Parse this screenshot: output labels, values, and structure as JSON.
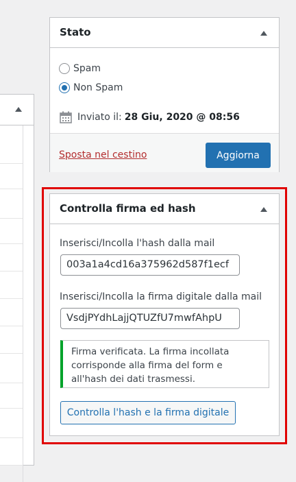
{
  "stato": {
    "title": "Stato",
    "radio_spam": "Spam",
    "radio_non_spam": "Non Spam",
    "selected": "Non Spam",
    "sent_label": "Inviato il:",
    "sent_date": "28 Giu, 2020 @ 08:56",
    "trash_link": "Sposta nel cestino",
    "update_button": "Aggiorna"
  },
  "hash_panel": {
    "title": "Controlla firma ed hash",
    "hash_label": "Inserisci/Incolla l'hash dalla mail",
    "hash_value": "003a1a4cd16a375962d587f1ecf",
    "signature_label": "Inserisci/Incolla la firma digitale dalla mail",
    "signature_value": "VsdjPYdhLajjQTUZfU7mwfAhpU",
    "notice": "Firma verificata. La firma incollata corrisponde alla firma del form e all'hash dei dati trasmessi.",
    "check_button": "Controlla l'hash e la firma digitale"
  },
  "colors": {
    "primary": "#2271b1",
    "trash": "#b32d2e",
    "success": "#00a32a",
    "highlight": "#e00000"
  }
}
